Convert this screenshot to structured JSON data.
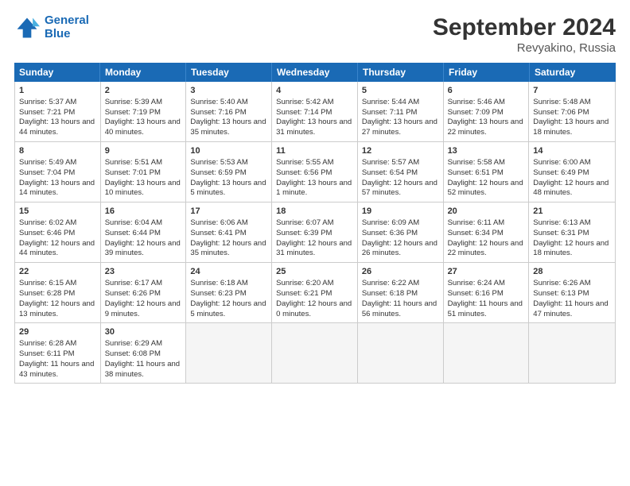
{
  "header": {
    "logo_line1": "General",
    "logo_line2": "Blue",
    "title": "September 2024",
    "subtitle": "Revyakino, Russia"
  },
  "days": [
    "Sunday",
    "Monday",
    "Tuesday",
    "Wednesday",
    "Thursday",
    "Friday",
    "Saturday"
  ],
  "weeks": [
    [
      {
        "day": "1",
        "sunrise": "5:37 AM",
        "sunset": "7:21 PM",
        "daylight": "13 hours and 44 minutes."
      },
      {
        "day": "2",
        "sunrise": "5:39 AM",
        "sunset": "7:19 PM",
        "daylight": "13 hours and 40 minutes."
      },
      {
        "day": "3",
        "sunrise": "5:40 AM",
        "sunset": "7:16 PM",
        "daylight": "13 hours and 35 minutes."
      },
      {
        "day": "4",
        "sunrise": "5:42 AM",
        "sunset": "7:14 PM",
        "daylight": "13 hours and 31 minutes."
      },
      {
        "day": "5",
        "sunrise": "5:44 AM",
        "sunset": "7:11 PM",
        "daylight": "13 hours and 27 minutes."
      },
      {
        "day": "6",
        "sunrise": "5:46 AM",
        "sunset": "7:09 PM",
        "daylight": "13 hours and 22 minutes."
      },
      {
        "day": "7",
        "sunrise": "5:48 AM",
        "sunset": "7:06 PM",
        "daylight": "13 hours and 18 minutes."
      }
    ],
    [
      {
        "day": "8",
        "sunrise": "5:49 AM",
        "sunset": "7:04 PM",
        "daylight": "13 hours and 14 minutes."
      },
      {
        "day": "9",
        "sunrise": "5:51 AM",
        "sunset": "7:01 PM",
        "daylight": "13 hours and 10 minutes."
      },
      {
        "day": "10",
        "sunrise": "5:53 AM",
        "sunset": "6:59 PM",
        "daylight": "13 hours and 5 minutes."
      },
      {
        "day": "11",
        "sunrise": "5:55 AM",
        "sunset": "6:56 PM",
        "daylight": "13 hours and 1 minute."
      },
      {
        "day": "12",
        "sunrise": "5:57 AM",
        "sunset": "6:54 PM",
        "daylight": "12 hours and 57 minutes."
      },
      {
        "day": "13",
        "sunrise": "5:58 AM",
        "sunset": "6:51 PM",
        "daylight": "12 hours and 52 minutes."
      },
      {
        "day": "14",
        "sunrise": "6:00 AM",
        "sunset": "6:49 PM",
        "daylight": "12 hours and 48 minutes."
      }
    ],
    [
      {
        "day": "15",
        "sunrise": "6:02 AM",
        "sunset": "6:46 PM",
        "daylight": "12 hours and 44 minutes."
      },
      {
        "day": "16",
        "sunrise": "6:04 AM",
        "sunset": "6:44 PM",
        "daylight": "12 hours and 39 minutes."
      },
      {
        "day": "17",
        "sunrise": "6:06 AM",
        "sunset": "6:41 PM",
        "daylight": "12 hours and 35 minutes."
      },
      {
        "day": "18",
        "sunrise": "6:07 AM",
        "sunset": "6:39 PM",
        "daylight": "12 hours and 31 minutes."
      },
      {
        "day": "19",
        "sunrise": "6:09 AM",
        "sunset": "6:36 PM",
        "daylight": "12 hours and 26 minutes."
      },
      {
        "day": "20",
        "sunrise": "6:11 AM",
        "sunset": "6:34 PM",
        "daylight": "12 hours and 22 minutes."
      },
      {
        "day": "21",
        "sunrise": "6:13 AM",
        "sunset": "6:31 PM",
        "daylight": "12 hours and 18 minutes."
      }
    ],
    [
      {
        "day": "22",
        "sunrise": "6:15 AM",
        "sunset": "6:28 PM",
        "daylight": "12 hours and 13 minutes."
      },
      {
        "day": "23",
        "sunrise": "6:17 AM",
        "sunset": "6:26 PM",
        "daylight": "12 hours and 9 minutes."
      },
      {
        "day": "24",
        "sunrise": "6:18 AM",
        "sunset": "6:23 PM",
        "daylight": "12 hours and 5 minutes."
      },
      {
        "day": "25",
        "sunrise": "6:20 AM",
        "sunset": "6:21 PM",
        "daylight": "12 hours and 0 minutes."
      },
      {
        "day": "26",
        "sunrise": "6:22 AM",
        "sunset": "6:18 PM",
        "daylight": "11 hours and 56 minutes."
      },
      {
        "day": "27",
        "sunrise": "6:24 AM",
        "sunset": "6:16 PM",
        "daylight": "11 hours and 51 minutes."
      },
      {
        "day": "28",
        "sunrise": "6:26 AM",
        "sunset": "6:13 PM",
        "daylight": "11 hours and 47 minutes."
      }
    ],
    [
      {
        "day": "29",
        "sunrise": "6:28 AM",
        "sunset": "6:11 PM",
        "daylight": "11 hours and 43 minutes."
      },
      {
        "day": "30",
        "sunrise": "6:29 AM",
        "sunset": "6:08 PM",
        "daylight": "11 hours and 38 minutes."
      },
      {
        "day": "",
        "sunrise": "",
        "sunset": "",
        "daylight": ""
      },
      {
        "day": "",
        "sunrise": "",
        "sunset": "",
        "daylight": ""
      },
      {
        "day": "",
        "sunrise": "",
        "sunset": "",
        "daylight": ""
      },
      {
        "day": "",
        "sunrise": "",
        "sunset": "",
        "daylight": ""
      },
      {
        "day": "",
        "sunrise": "",
        "sunset": "",
        "daylight": ""
      }
    ]
  ]
}
